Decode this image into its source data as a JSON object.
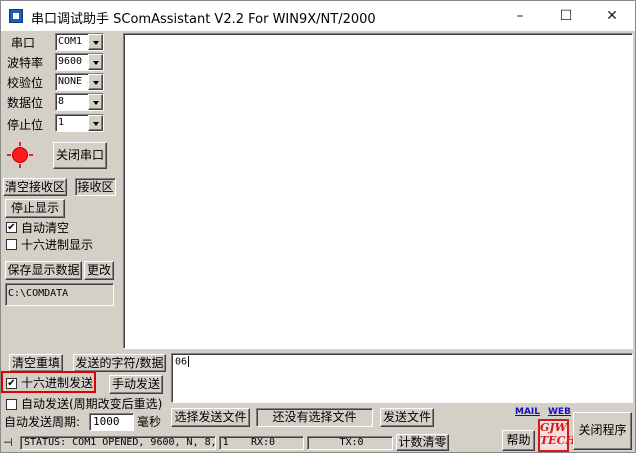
{
  "window": {
    "title": "串口调试助手 SComAssistant V2.2 For WIN9X/NT/2000",
    "minimize_icon": "minimize-icon",
    "maximize_icon": "maximize-icon",
    "close_icon": "close-icon"
  },
  "port_settings": {
    "port_label": "串口",
    "port_value": "COM1",
    "baud_label": "波特率",
    "baud_value": "9600",
    "parity_label": "校验位",
    "parity_value": "NONE",
    "databits_label": "数据位",
    "databits_value": "8",
    "stopbits_label": "停止位",
    "stopbits_value": "1",
    "close_port_button": "关闭串口",
    "status_led_color": "#ff1a1a"
  },
  "receive_controls": {
    "clear_receive_button": "清空接收区",
    "receive_area_label": "接收区",
    "stop_display_button": "停止显示",
    "auto_clear_label": "自动清空",
    "auto_clear_checked": true,
    "hex_display_label": "十六进制显示",
    "hex_display_checked": false,
    "save_data_button": "保存显示数据",
    "change_button": "更改",
    "save_path": "C:\\COMDATA"
  },
  "send_controls": {
    "clear_refill_button": "清空重填",
    "send_chars_label": "发送的字符/数据",
    "hex_send_label": "十六进制发送",
    "hex_send_checked": true,
    "manual_send_button": "手动发送",
    "auto_send_label": "自动发送(周期改变后重选)",
    "auto_send_checked": false,
    "period_label": "自动发送周期:",
    "period_value": "1000",
    "period_unit": "毫秒",
    "select_file_button": "选择发送文件",
    "file_status": "还没有选择文件",
    "send_file_button": "发送文件",
    "send_text": "06"
  },
  "links": {
    "mail": "MAIL",
    "web": "WEB"
  },
  "status_bar": {
    "status_text": "STATUS: COM1 OPENED, 9600, N, 8, 1",
    "rx_text": "RX:0",
    "tx_text": "TX:0",
    "reset_count_button": "计数清零"
  },
  "bottom_buttons": {
    "help_button": "帮助",
    "close_program_button": "关闭程序",
    "logo_line1": "GJW",
    "logo_line2": "TECH"
  },
  "colors": {
    "window_face": "#d4d0c8",
    "highlight_border": "#e00000",
    "link_color": "#1010c0",
    "logo_color": "#d81818"
  }
}
